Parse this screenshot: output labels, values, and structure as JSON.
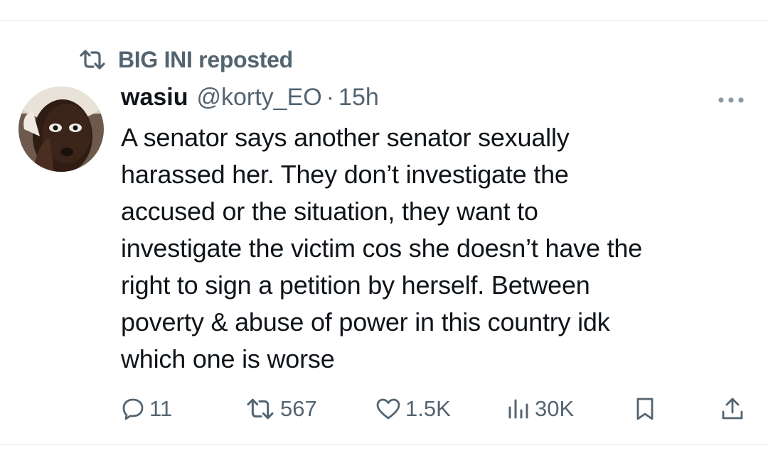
{
  "repost": {
    "icon": "repost-icon",
    "label": "BIG INI reposted"
  },
  "tweet": {
    "author": {
      "display_name": "wasiu",
      "handle": "@korty_EO",
      "separator": "·",
      "time": "15h",
      "avatar_icon": "avatar-photo"
    },
    "more_icon": "more-options-icon",
    "text": "A senator says another senator sexually\nharassed her. They don’t investigate the\naccused or the situation, they want to\ninvestigate the victim cos she doesn’t have the\nright to sign a petition by herself. Between\npoverty & abuse of power in this country idk\nwhich one is worse",
    "actions": {
      "reply": {
        "icon": "reply-icon",
        "count": "11"
      },
      "retweet": {
        "icon": "repost-icon",
        "count": "567"
      },
      "like": {
        "icon": "heart-icon",
        "count": "1.5K"
      },
      "views": {
        "icon": "views-icon",
        "count": "30K"
      },
      "bookmark": {
        "icon": "bookmark-icon"
      },
      "share": {
        "icon": "share-icon"
      }
    }
  },
  "colors": {
    "text_primary": "#0f1419",
    "text_secondary": "#536471",
    "divider": "#e6e9ec",
    "background": "#ffffff"
  }
}
